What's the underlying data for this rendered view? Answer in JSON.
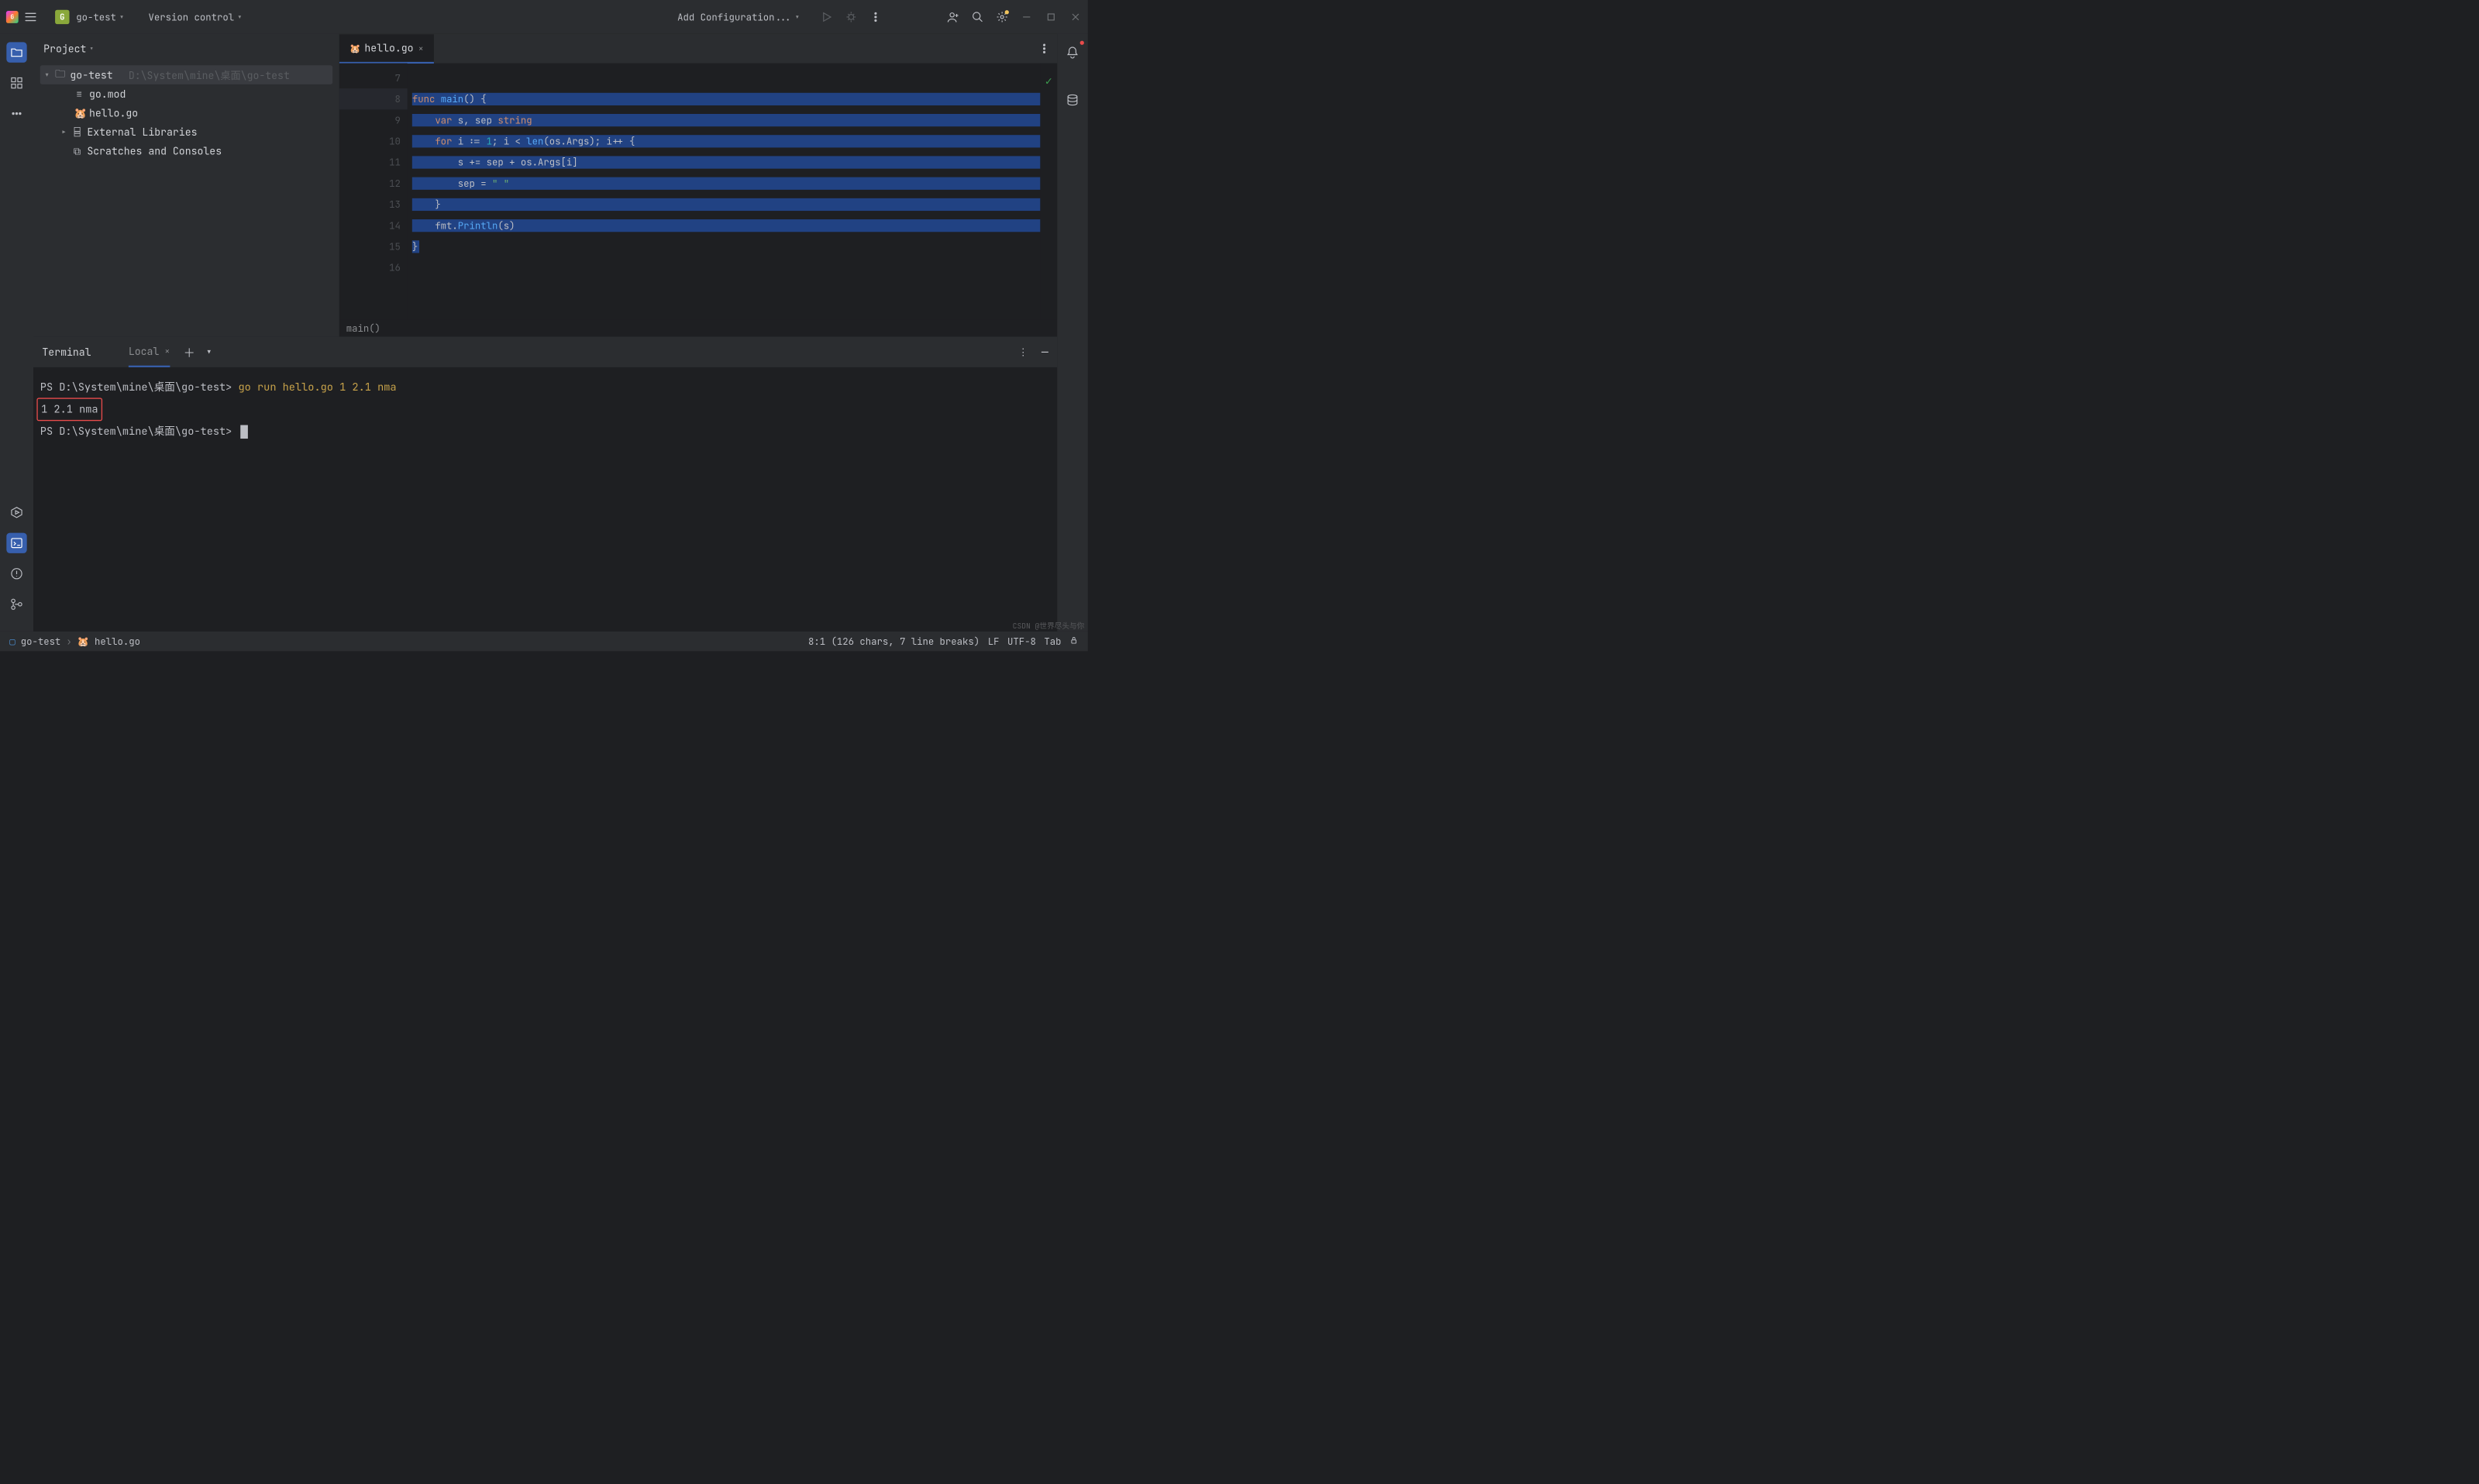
{
  "titlebar": {
    "project_badge": "G",
    "project_name": "go-test",
    "menu_vc": "Version control",
    "run_config": "Add Configuration..."
  },
  "project_panel": {
    "title": "Project",
    "root": {
      "name": "go-test",
      "path": "D:\\System\\mine\\桌面\\go-test"
    },
    "files": [
      {
        "icon": "≡",
        "name": "go.mod"
      },
      {
        "icon": "🐹",
        "name": "hello.go"
      }
    ],
    "external": "External Libraries",
    "scratches": "Scratches and Consoles"
  },
  "editor": {
    "tab_name": "hello.go",
    "breadcrumb": "main()",
    "lines": [
      {
        "num": "7",
        "tokens": []
      },
      {
        "num": "8",
        "run": true,
        "sel": true,
        "tokens": [
          [
            "kw",
            "func "
          ],
          [
            "fn",
            "main"
          ],
          [
            "pn",
            "() {"
          ]
        ]
      },
      {
        "num": "9",
        "sel": true,
        "tokens": [
          [
            "pn",
            "    "
          ],
          [
            "kw",
            "var "
          ],
          [
            "id",
            "s"
          ],
          [
            "pn",
            ", "
          ],
          [
            "id",
            "sep "
          ],
          [
            "ty",
            "string"
          ]
        ]
      },
      {
        "num": "10",
        "sel": true,
        "tokens": [
          [
            "pn",
            "    "
          ],
          [
            "kw",
            "for "
          ],
          [
            "id",
            "i "
          ],
          [
            "pn",
            ":= "
          ],
          [
            "num",
            "1"
          ],
          [
            "pn",
            "; "
          ],
          [
            "id",
            "i "
          ],
          [
            "pn",
            "< "
          ],
          [
            "fn",
            "len"
          ],
          [
            "pn",
            "("
          ],
          [
            "id",
            "os"
          ],
          [
            "pn",
            "."
          ],
          [
            "id",
            "Args"
          ],
          [
            "pn",
            "); "
          ],
          [
            "id",
            "i"
          ],
          [
            "pn",
            "++ {"
          ]
        ]
      },
      {
        "num": "11",
        "sel": true,
        "tokens": [
          [
            "pn",
            "        "
          ],
          [
            "id",
            "s "
          ],
          [
            "pn",
            "+= "
          ],
          [
            "id",
            "sep "
          ],
          [
            "pn",
            "+ "
          ],
          [
            "id",
            "os"
          ],
          [
            "pn",
            "."
          ],
          [
            "id",
            "Args"
          ],
          [
            "pn",
            "["
          ],
          [
            "id",
            "i"
          ],
          [
            "pn",
            "]"
          ]
        ]
      },
      {
        "num": "12",
        "sel": true,
        "tokens": [
          [
            "pn",
            "        "
          ],
          [
            "id",
            "sep "
          ],
          [
            "pn",
            "= "
          ],
          [
            "str",
            "\" \""
          ]
        ]
      },
      {
        "num": "13",
        "sel": true,
        "tokens": [
          [
            "pn",
            "    }"
          ]
        ]
      },
      {
        "num": "14",
        "sel": true,
        "tokens": [
          [
            "pn",
            "    "
          ],
          [
            "id",
            "fmt"
          ],
          [
            "pn",
            "."
          ],
          [
            "fn",
            "Println"
          ],
          [
            "pn",
            "("
          ],
          [
            "id",
            "s"
          ],
          [
            "pn",
            ")"
          ]
        ]
      },
      {
        "num": "15",
        "sel": "partial",
        "tokens": [
          [
            "pn",
            "}"
          ]
        ]
      },
      {
        "num": "16",
        "tokens": []
      }
    ]
  },
  "terminal": {
    "title": "Terminal",
    "tab": "Local",
    "lines": [
      {
        "type": "cmd",
        "prompt": "PS D:\\System\\mine\\桌面\\go-test> ",
        "command": "go run hello.go 1 2.1 nma"
      },
      {
        "type": "out-box",
        "text": "1 2.1 nma"
      },
      {
        "type": "prompt",
        "prompt": "PS D:\\System\\mine\\桌面\\go-test> "
      }
    ]
  },
  "statusbar": {
    "breadcrumb_root": "go-test",
    "breadcrumb_file": "hello.go",
    "position": "8:1 (126 chars, 7 line breaks)",
    "eol": "LF",
    "encoding": "UTF-8",
    "indent": "Tab"
  },
  "watermark": "CSDN @世界尽头与你"
}
